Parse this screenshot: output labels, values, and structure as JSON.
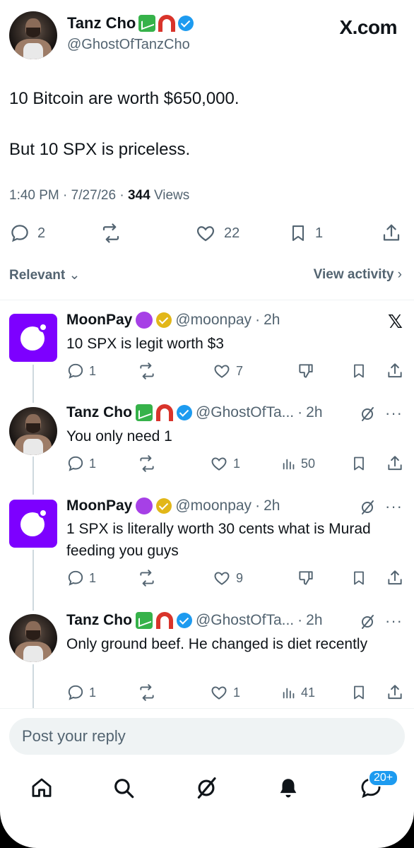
{
  "main_tweet": {
    "name": "Tanz Cho",
    "handle": "@GhostOfTanzCho",
    "site_logo": "X.com",
    "text": "10 Bitcoin are worth $650,000.\n\nBut 10 SPX is priceless.",
    "time": "1:40 PM",
    "date": "7/27/26",
    "views": "344",
    "views_label": "Views",
    "replies": "2",
    "likes": "22",
    "bookmarks": "1"
  },
  "filters": {
    "sort": "Relevant",
    "activity": "View activity"
  },
  "replies": [
    {
      "name": "MoonPay",
      "handle": "@moonpay",
      "age": "2h",
      "text": "10 SPX is legit worth $3",
      "reply_count": "1",
      "like_count": "7"
    },
    {
      "name": "Tanz Cho",
      "handle": "@GhostOfTa...",
      "age": "2h",
      "text": "You only need 1",
      "reply_count": "1",
      "like_count": "1",
      "view_count": "50"
    },
    {
      "name": "MoonPay",
      "handle": "@moonpay",
      "age": "2h",
      "text": "1 SPX is literally worth 30 cents what is Murad feeding you guys",
      "reply_count": "1",
      "like_count": "9"
    },
    {
      "name": "Tanz Cho",
      "handle": "@GhostOfTa...",
      "age": "2h",
      "text": "Only ground beef. He changed is diet recently",
      "reply_count": "1",
      "like_count": "1",
      "view_count": "41"
    }
  ],
  "composer": {
    "placeholder": "Post your reply"
  },
  "nav": {
    "messages_badge": "20+"
  },
  "colors": {
    "accent": "#1d9bf0",
    "secondary_text": "#536471",
    "moonpay_purple": "#7d00ff",
    "gold_verified": "#e2b719"
  }
}
